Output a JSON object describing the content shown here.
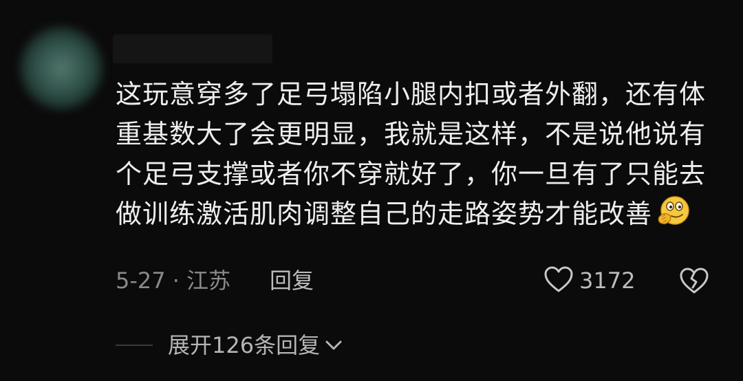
{
  "comment": {
    "text": "这玩意穿多了足弓塌陷小腿内扣或者外翻，还有体重基数大了会更明显，我就是这样，不是说他说有个足弓支撑或者你不穿就好了，你一旦有了只能去做训练激活肌肉调整自己的走路姿势才能改善",
    "emoji": "face-with-hand-over-mouth-emoji",
    "date_location": "5-27 · 江苏",
    "reply_label": "回复",
    "like_count": "3172"
  },
  "replies": {
    "expand_label": "展开126条回复"
  },
  "icons": {
    "like": "heart-outline-icon",
    "dislike": "broken-heart-icon",
    "expand": "chevron-down-icon"
  },
  "colors": {
    "background": "#0b0b0b",
    "text": "#eeeeee",
    "muted": "#8a8a8a",
    "emoji": "#f5c93a"
  }
}
